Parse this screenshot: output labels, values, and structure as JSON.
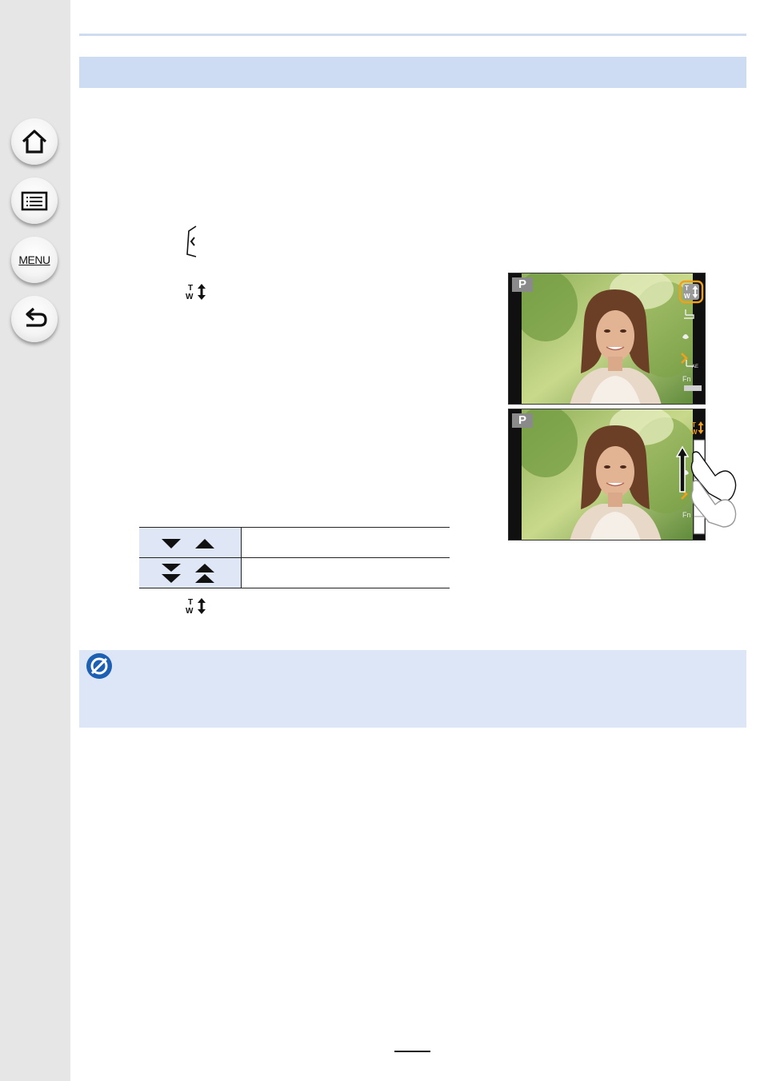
{
  "sidebar": {
    "buttons": [
      {
        "name": "home",
        "icon": "home-icon"
      },
      {
        "name": "contents",
        "icon": "list-icon"
      },
      {
        "name": "menu",
        "icon": "menu-icon",
        "label": "MENU"
      },
      {
        "name": "back",
        "icon": "back-arrow-icon"
      }
    ]
  },
  "inline_icons": [
    "tab-open-icon",
    "zoom-tw-icon",
    "zoom-tw-icon"
  ],
  "screens": {
    "top": {
      "mode": "P"
    },
    "bottom": {
      "mode": "P"
    }
  },
  "table": {
    "rows": [
      {
        "key_icons": [
          "triangle-down-icon",
          "triangle-up-icon"
        ]
      },
      {
        "key_icons": [
          "double-triangle-down-icon",
          "double-triangle-up-icon"
        ]
      }
    ]
  },
  "note": {
    "icon": "not-available-icon"
  },
  "colors": {
    "accent_blue": "#1c5fb3",
    "highlight_orange": "#f0a01c",
    "section_bar": "#cddcf3",
    "note_bg": "#dde6f6"
  }
}
